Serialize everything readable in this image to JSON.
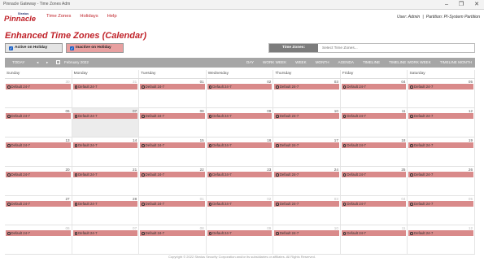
{
  "window": {
    "title": "Pinnacle Gateway - Time Zones Adm",
    "min": "–",
    "restore": "❐",
    "close": "✕"
  },
  "brand": {
    "sup": "Stratus",
    "name": "Pinnacle"
  },
  "menu": [
    "Time Zones",
    "Holidays",
    "Help"
  ],
  "user": {
    "user_text": "User: Admin",
    "sep": "|",
    "partition_text": "Partition: PI-System Partition"
  },
  "page_title": "Enhanced Time Zones (Calendar)",
  "toggles": {
    "active_on_holiday": "Active on Holiday",
    "inactive_on_holiday": "Inactive on Holiday"
  },
  "tz": {
    "label": "Time Zones:",
    "placeholder": "Select Time Zones..."
  },
  "toolbar": {
    "today": "TODAY",
    "prev": "◂",
    "next": "▸",
    "month_label": "February 2022",
    "views": [
      "DAY",
      "WORK WEEK",
      "WEEK",
      "MONTH",
      "AGENDA",
      "TIMELINE",
      "TIMELINE WORK WEEK",
      "TIMELINE MONTH"
    ]
  },
  "calendar": {
    "day_headers": [
      "Sunday",
      "Monday",
      "Tuesday",
      "Wednesday",
      "Thursday",
      "Friday",
      "Saturday"
    ],
    "event_label": "Default 24-7",
    "today_index": 8,
    "weeks": [
      [
        "30",
        "31",
        "01",
        "02",
        "03",
        "04",
        "05"
      ],
      [
        "06",
        "07",
        "08",
        "09",
        "10",
        "11",
        "12"
      ],
      [
        "13",
        "14",
        "15",
        "16",
        "17",
        "18",
        "19"
      ],
      [
        "20",
        "21",
        "22",
        "23",
        "24",
        "25",
        "26"
      ],
      [
        "27",
        "28",
        "01",
        "02",
        "03",
        "04",
        "05"
      ],
      [
        "06",
        "07",
        "08",
        "09",
        "10",
        "11",
        "12"
      ]
    ],
    "other_month": [
      [
        true,
        true,
        false,
        false,
        false,
        false,
        false
      ],
      [
        false,
        false,
        false,
        false,
        false,
        false,
        false
      ],
      [
        false,
        false,
        false,
        false,
        false,
        false,
        false
      ],
      [
        false,
        false,
        false,
        false,
        false,
        false,
        false
      ],
      [
        false,
        false,
        true,
        true,
        true,
        true,
        true
      ],
      [
        true,
        true,
        true,
        true,
        true,
        true,
        true
      ]
    ]
  },
  "footer": "Copyright © 2022 Stratus Security Corporation and/or its subsidiaries or affiliates. All Rights Reserved."
}
